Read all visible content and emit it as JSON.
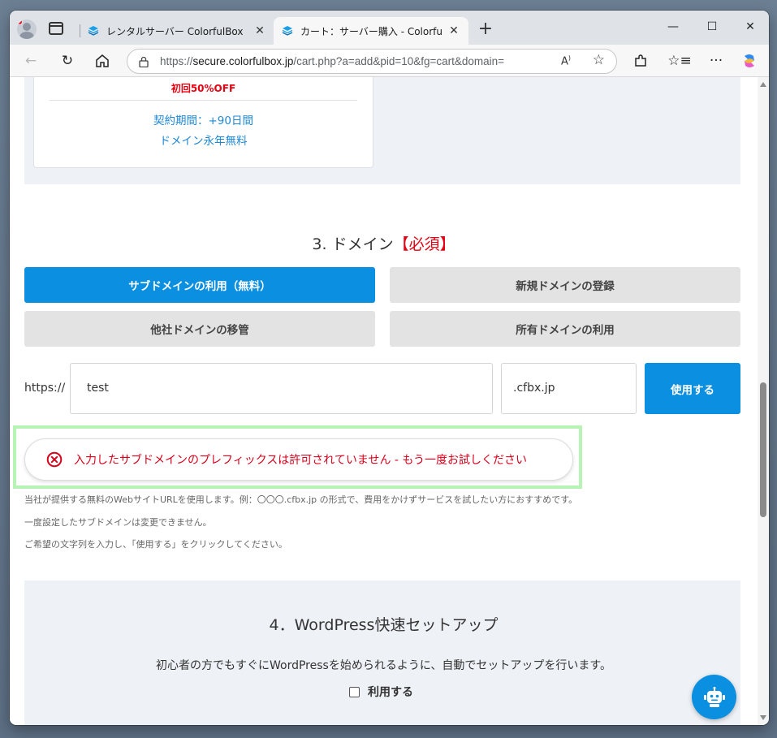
{
  "browser": {
    "tabs": [
      {
        "title": "レンタルサーバー ColorfulBox（カラフ",
        "active": false
      },
      {
        "title": "カート：サーバー購入 - ColorfulBox",
        "active": true
      }
    ],
    "url_prefix": "https://",
    "url_host": "secure.colorfulbox.jp",
    "url_path": "/cart.php?a=add&pid=10&fg=cart&domain="
  },
  "plan": {
    "discount": "初回50%OFF",
    "term": "契約期間：+90日間",
    "domain_free": "ドメイン永年無料"
  },
  "domain_section": {
    "title": "3. ドメイン",
    "required": "【必須】",
    "options": [
      {
        "label": "サブドメインの利用（無料）",
        "active": true
      },
      {
        "label": "新規ドメインの登録",
        "active": false
      },
      {
        "label": "他社ドメインの移管",
        "active": false
      },
      {
        "label": "所有ドメインの利用",
        "active": false
      }
    ],
    "prefix_label": "https://",
    "subdomain_value": "test",
    "suffix_value": ".cfbx.jp",
    "use_button": "使用する",
    "error_message": "入力したサブドメインのプレフィックスは許可されていません - もう一度お試しください",
    "notes": [
      "当社が提供する無料のWebサイトURLを使用します。例：〇〇〇.cfbx.jp の形式で、費用をかけずサービスを試したい方におすすめです。",
      "一度設定したサブドメインは変更できません。",
      "ご希望の文字列を入力し、「使用する」をクリックしてください。"
    ]
  },
  "wp_section": {
    "title": "4．WordPress快速セットアップ",
    "description": "初心者の方でもすぐにWordPressを始められるように、自動でセットアップを行います。",
    "checkbox_label": "利用する",
    "checked": false
  },
  "colors": {
    "accent": "#0b8fe0",
    "error": "#d8001a",
    "required": "#e60012",
    "highlight_frame": "#b6f3b5"
  }
}
